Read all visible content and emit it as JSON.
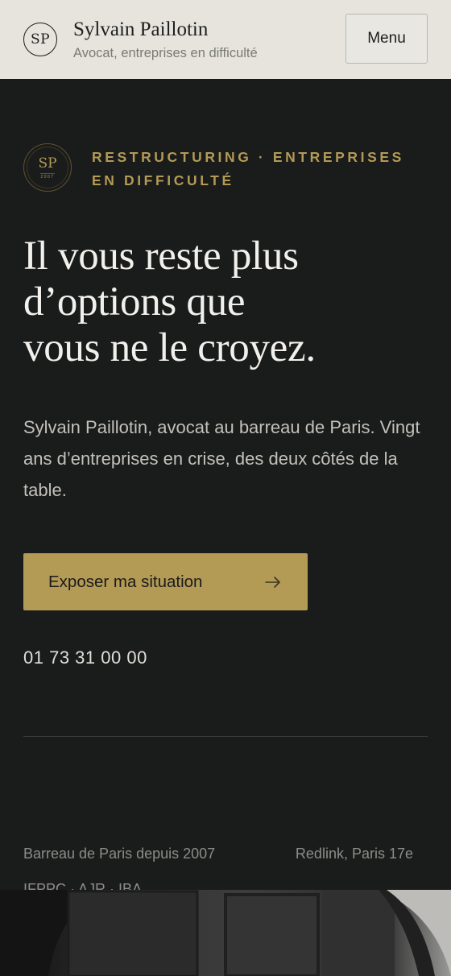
{
  "header": {
    "monogram": "SP",
    "name": "Sylvain Paillotin",
    "tagline": "Avocat, entreprises en difficulté",
    "menu_label": "Menu"
  },
  "hero": {
    "seal_initials": "SP",
    "seal_year": "2007",
    "kicker": "RESTRUCTURING · ENTREPRISES EN DIFFICULTÉ",
    "headline_lines": [
      "Il vous reste plus",
      "d’options que",
      "vous ne le croyez."
    ],
    "lead": "Sylvain Paillotin, avocat au barreau de Paris. Vingt ans d’entreprises en crise, des deux côtés de la table.",
    "cta_label": "Exposer ma situation",
    "phone": "01 73 31 00 00"
  },
  "credentials": {
    "bar": "Barreau de Paris depuis 2007",
    "office": "Redlink, Paris 17e",
    "memberships": "IFPPC · AJR · IBA"
  },
  "colors": {
    "accent": "#b39a55",
    "background": "#1a1b1b",
    "header_bg": "#e6e4dd"
  },
  "icons": {
    "cta": "arrow-right-icon"
  }
}
